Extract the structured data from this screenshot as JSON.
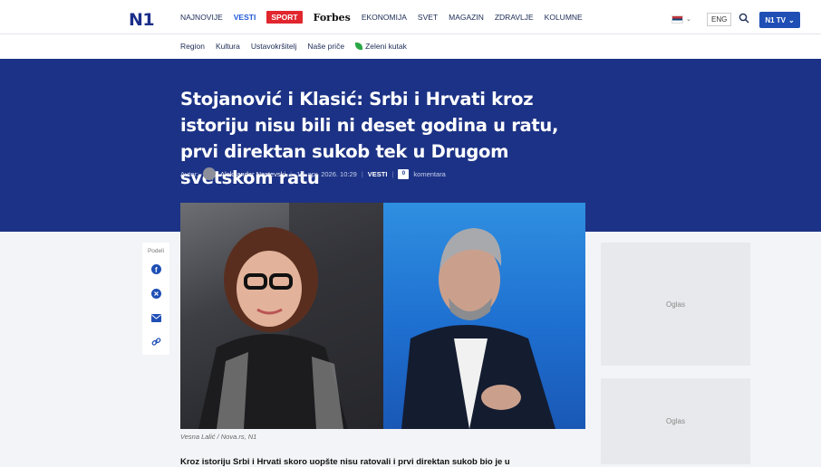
{
  "header": {
    "logo": "N1",
    "nav": [
      "NAJNOVIJE",
      "VESTI",
      "SPORT",
      "Forbes",
      "EKONOMIJA",
      "SVET",
      "MAGAZIN",
      "ZDRAVLJE",
      "KOLUMNE"
    ],
    "lang": "ENG",
    "tv_button": "N1 TV"
  },
  "subnav": [
    "Region",
    "Kultura",
    "Ustavokršitelj",
    "Naše priče",
    "Zeleni kutak"
  ],
  "article": {
    "title": "Stojanović i Klasić: Srbi i Hrvati kroz istoriju nisu bili ni deset godina u ratu, prvi direktan sukob tek u Drugom svetskom ratu",
    "author_label": "Autor:",
    "author": "Aleksandar Nastevski",
    "date": "13. apr. 2026. 10:29",
    "category": "VESTI",
    "comments_label": "komentara",
    "comments_count": "0",
    "caption": "Vesna Lalić / Nova.rs, N1",
    "lead": "Kroz istoriju Srbi i Hrvati skoro uopšte nisu ratovali i prvi direktan sukob bio je u"
  },
  "share": {
    "label": "Podeli"
  },
  "ads": [
    "Oglas",
    "Oglas"
  ],
  "colors": {
    "hero": "#1c3286",
    "accent": "#1f5ad8",
    "sport": "#e1262e"
  }
}
